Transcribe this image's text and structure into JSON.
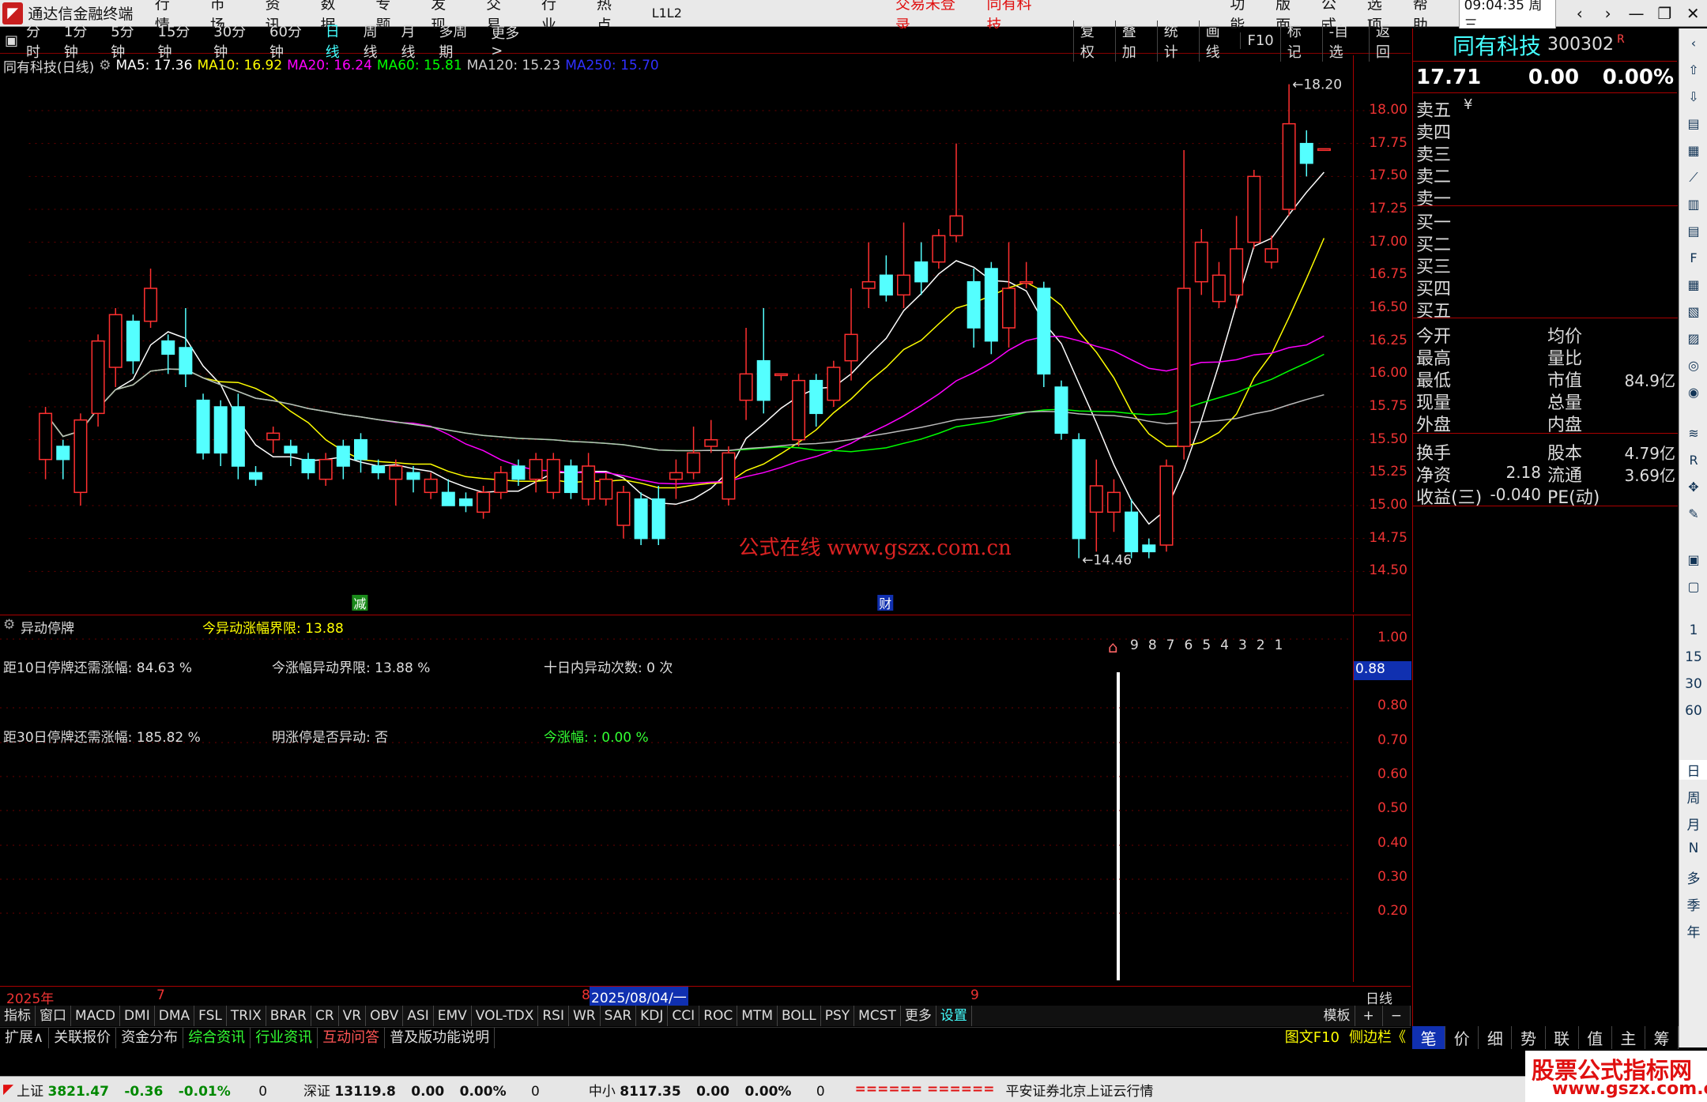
{
  "app": {
    "name": "通达信金融终端",
    "menu": [
      "行情",
      "市场",
      "资讯",
      "数据",
      "专题",
      "发现",
      "交易",
      "行业",
      "热点",
      "L1L2"
    ],
    "login_status": "交易未登录",
    "current_stock": "同有科技",
    "right_menu": [
      "功能",
      "版面",
      "公式",
      "选项",
      "帮助"
    ],
    "clock": "09:04:35",
    "weekday": "周三"
  },
  "periods": [
    "分时",
    "1分钟",
    "5分钟",
    "15分钟",
    "30分钟",
    "60分钟",
    "日线",
    "周线",
    "月线",
    "多周期",
    "更多 >"
  ],
  "active_period": "日线",
  "tools": [
    "复权",
    "叠加",
    "统计",
    "画线",
    "F10",
    "标记",
    "-自选",
    "返回"
  ],
  "chart_title": "同有科技(日线)",
  "ma": [
    {
      "label": "MA5: 17.36",
      "color": "#ffffff"
    },
    {
      "label": "MA10: 16.92",
      "color": "#ffff00"
    },
    {
      "label": "MA20: 16.24",
      "color": "#ff00ff"
    },
    {
      "label": "MA60: 15.81",
      "color": "#00ff00"
    },
    {
      "label": "MA120: 15.23",
      "color": "#cccccc"
    },
    {
      "label": "MA250: 15.70",
      "color": "#3030ff"
    }
  ],
  "price_axis": [
    "18.00",
    "17.75",
    "17.50",
    "17.25",
    "17.00",
    "16.75",
    "16.50",
    "16.25",
    "16.00",
    "15.75",
    "15.50",
    "15.25",
    "15.00",
    "14.75",
    "14.50"
  ],
  "high_mark": "18.20",
  "low_mark": "14.46",
  "event_marks": [
    "减",
    "财"
  ],
  "watermark": "公式在线  www.gszx.com.cn",
  "chart_data": {
    "type": "candlestick",
    "ylim": [
      14.4,
      18.3
    ],
    "candles": [
      [
        15.35,
        15.7,
        15.2,
        15.75
      ],
      [
        15.45,
        15.35,
        15.2,
        15.5
      ],
      [
        15.1,
        15.65,
        15.0,
        15.7
      ],
      [
        15.7,
        16.25,
        15.6,
        16.3
      ],
      [
        16.05,
        16.45,
        15.9,
        16.5
      ],
      [
        16.4,
        16.1,
        16.0,
        16.45
      ],
      [
        16.4,
        16.65,
        16.35,
        16.8
      ],
      [
        16.25,
        16.15,
        16.0,
        16.3
      ],
      [
        16.2,
        16.0,
        15.9,
        16.5
      ],
      [
        15.8,
        15.4,
        15.35,
        15.85
      ],
      [
        15.75,
        15.4,
        15.3,
        15.8
      ],
      [
        15.75,
        15.3,
        15.2,
        15.85
      ],
      [
        15.25,
        15.2,
        15.15,
        15.3
      ],
      [
        15.5,
        15.55,
        15.4,
        15.6
      ],
      [
        15.45,
        15.4,
        15.3,
        15.5
      ],
      [
        15.35,
        15.25,
        15.2,
        15.4
      ],
      [
        15.2,
        15.35,
        15.15,
        15.4
      ],
      [
        15.45,
        15.3,
        15.2,
        15.5
      ],
      [
        15.5,
        15.35,
        15.25,
        15.55
      ],
      [
        15.3,
        15.25,
        15.2,
        15.35
      ],
      [
        15.2,
        15.3,
        15.0,
        15.35
      ],
      [
        15.25,
        15.2,
        15.1,
        15.3
      ],
      [
        15.1,
        15.2,
        15.05,
        15.25
      ],
      [
        15.1,
        15.0,
        15.0,
        15.2
      ],
      [
        15.05,
        15.0,
        14.95,
        15.1
      ],
      [
        14.95,
        15.1,
        14.9,
        15.15
      ],
      [
        15.1,
        15.25,
        15.05,
        15.3
      ],
      [
        15.3,
        15.2,
        15.15,
        15.35
      ],
      [
        15.2,
        15.35,
        15.1,
        15.4
      ],
      [
        15.1,
        15.35,
        15.05,
        15.4
      ],
      [
        15.3,
        15.1,
        15.05,
        15.35
      ],
      [
        15.05,
        15.3,
        15.0,
        15.4
      ],
      [
        15.05,
        15.2,
        15.0,
        15.25
      ],
      [
        14.85,
        15.1,
        14.75,
        15.15
      ],
      [
        15.05,
        14.75,
        14.7,
        15.1
      ],
      [
        15.05,
        14.75,
        14.7,
        15.15
      ],
      [
        15.2,
        15.25,
        15.05,
        15.35
      ],
      [
        15.25,
        15.4,
        15.2,
        15.6
      ],
      [
        15.45,
        15.5,
        15.4,
        15.65
      ],
      [
        15.05,
        15.4,
        15.0,
        15.45
      ],
      [
        15.8,
        16.0,
        15.65,
        16.35
      ],
      [
        16.1,
        15.8,
        15.7,
        16.5
      ],
      [
        16.0,
        16.0,
        15.95,
        16.0
      ],
      [
        15.5,
        15.95,
        15.45,
        16.0
      ],
      [
        15.95,
        15.7,
        15.6,
        16.0
      ],
      [
        15.8,
        16.05,
        15.75,
        16.1
      ],
      [
        16.1,
        16.3,
        15.95,
        16.65
      ],
      [
        16.65,
        16.7,
        16.5,
        17.0
      ],
      [
        16.75,
        16.6,
        16.55,
        16.9
      ],
      [
        16.6,
        16.75,
        16.5,
        17.15
      ],
      [
        16.85,
        16.7,
        16.6,
        17.0
      ],
      [
        16.85,
        17.05,
        16.8,
        17.1
      ],
      [
        17.05,
        17.2,
        17.0,
        17.75
      ],
      [
        16.7,
        16.35,
        16.2,
        16.8
      ],
      [
        16.8,
        16.25,
        16.15,
        16.85
      ],
      [
        16.35,
        16.65,
        16.2,
        17.0
      ],
      [
        16.7,
        16.7,
        16.65,
        16.85
      ],
      [
        16.65,
        16.0,
        15.9,
        16.7
      ],
      [
        15.9,
        15.55,
        15.5,
        15.95
      ],
      [
        15.5,
        14.75,
        14.6,
        15.55
      ],
      [
        14.95,
        15.15,
        14.65,
        15.35
      ],
      [
        14.95,
        15.1,
        14.8,
        15.2
      ],
      [
        14.95,
        14.65,
        14.6,
        15.05
      ],
      [
        14.7,
        14.65,
        14.6,
        14.75
      ],
      [
        14.7,
        15.3,
        14.65,
        15.35
      ],
      [
        15.45,
        16.65,
        15.35,
        17.7
      ],
      [
        16.7,
        17.0,
        16.6,
        17.1
      ],
      [
        16.55,
        16.75,
        16.5,
        16.85
      ],
      [
        16.6,
        16.95,
        16.5,
        17.2
      ],
      [
        17.0,
        17.5,
        16.95,
        17.55
      ],
      [
        16.85,
        16.95,
        16.8,
        17.05
      ],
      [
        17.25,
        17.9,
        17.2,
        18.2
      ],
      [
        17.75,
        17.6,
        17.5,
        17.85
      ],
      [
        17.71,
        17.71,
        17.71,
        17.71
      ]
    ]
  },
  "sub_panel": {
    "name": "异动停牌",
    "threshold_label": "今异动涨幅界限: 13.88",
    "lines": [
      "距10日停牌还需涨幅: 84.63 %",
      "今涨幅异动界限: 13.88 %",
      "十日内异动次数: 0 次",
      "距30日停牌还需涨幅: 185.82 %",
      "明涨停是否异动: 否",
      "今涨幅: : 0.00 %"
    ],
    "countdown": [
      "9",
      "8",
      "7",
      "6",
      "5",
      "4",
      "3",
      "2",
      "1"
    ],
    "axis": [
      "1.00",
      "0.80",
      "0.70",
      "0.60",
      "0.50",
      "0.40",
      "0.30",
      "0.20"
    ],
    "axis_highlight": "0.88"
  },
  "date_bar": {
    "year": "2025年",
    "m7": "7",
    "m8": "8",
    "cursor": "2025/08/04/一",
    "m9": "9",
    "period": "日线"
  },
  "indicator_tabs": [
    "指标",
    "窗口",
    "MACD",
    "DMI",
    "DMA",
    "FSL",
    "TRIX",
    "BRAR",
    "CR",
    "VR",
    "OBV",
    "ASI",
    "EMV",
    "VOL-TDX",
    "RSI",
    "WR",
    "SAR",
    "KDJ",
    "CCI",
    "ROC",
    "MTM",
    "BOLL",
    "PSY",
    "MCST",
    "更多",
    "设置"
  ],
  "template_label": "模板",
  "bottom_tabs": [
    "扩展∧",
    "关联报价",
    "资金分布",
    "综合资讯",
    "行业资讯",
    "互动问答",
    "普及版功能说明"
  ],
  "f10_link": "图文F10",
  "sidebar_link": "侧边栏《",
  "quote": {
    "name": "同有科技",
    "code": "300302",
    "price": "17.71",
    "change": "0.00",
    "pct": "0.00%",
    "sell": [
      "卖五",
      "卖四",
      "卖三",
      "卖二",
      "卖一"
    ],
    "buy": [
      "买一",
      "买二",
      "买三",
      "买四",
      "买五"
    ],
    "left_labels": [
      "今开",
      "最高",
      "最低",
      "现量",
      "外盘",
      "换手",
      "净资",
      "收益(三)"
    ],
    "right_labels": [
      "均价",
      "量比",
      "市值",
      "总量",
      "内盘",
      "股本",
      "流通",
      "PE(动)"
    ],
    "left_values": [
      "",
      "",
      "",
      "",
      "",
      "",
      "2.18",
      "-0.040"
    ],
    "right_values": [
      "",
      "",
      "84.9亿",
      "",
      "",
      "4.79亿",
      "3.69亿",
      ""
    ],
    "tabs": [
      "笔",
      "价",
      "细",
      "势",
      "联",
      "值",
      "主",
      "筹"
    ]
  },
  "rail_text": [
    "1",
    "15",
    "30",
    "60",
    "日",
    "周",
    "月",
    "N",
    "多",
    "季",
    "年"
  ],
  "status": {
    "sh_name": "上证",
    "sh_val": "3821.47",
    "sh_chg": "-0.36",
    "sh_pct": "-0.01%",
    "sh_vol": "0",
    "sz_name": "深证",
    "sz_val": "13119.8",
    "sz_chg": "0.00",
    "sz_pct": "0.00%",
    "sz_vol": "0",
    "zx_name": "中小",
    "zx_val": "8117.35",
    "zx_chg": "0.00",
    "zx_pct": "0.00%",
    "zx_vol": "0",
    "bars": "====== ======",
    "broker": "平安证券北京上证云行情"
  },
  "banner": {
    "line1": "股票公式指标网",
    "line2": "www.gszx.com.cn"
  },
  "colors": {
    "up": "#ff3030",
    "down": "#54ffff",
    "axis_red": "#e33333",
    "accent": "#44ffff"
  }
}
